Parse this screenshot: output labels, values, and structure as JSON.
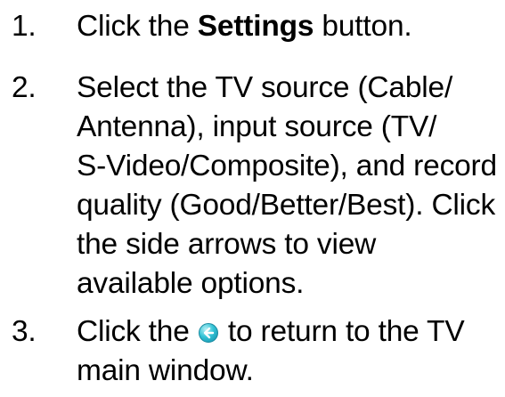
{
  "steps": [
    {
      "number": "1.",
      "text_before": "Click the ",
      "bold": "Settings",
      "text_after": " button."
    },
    {
      "number": "2.",
      "lines": [
        "Select the TV source (Cable/",
        "Antenna), input source (TV/",
        "S-Video/Composite), and record",
        "quality (Good/Better/Best). Click",
        "the side arrows to view",
        "available options."
      ]
    },
    {
      "number": "3.",
      "text_before": "Click the ",
      "icon": "back-arrow-icon",
      "text_after_line1": " to return to the TV",
      "text_line2": "main window."
    }
  ],
  "colors": {
    "text": "#000000",
    "icon_fill": "#34c3d6",
    "icon_arrow": "#ffffff"
  }
}
